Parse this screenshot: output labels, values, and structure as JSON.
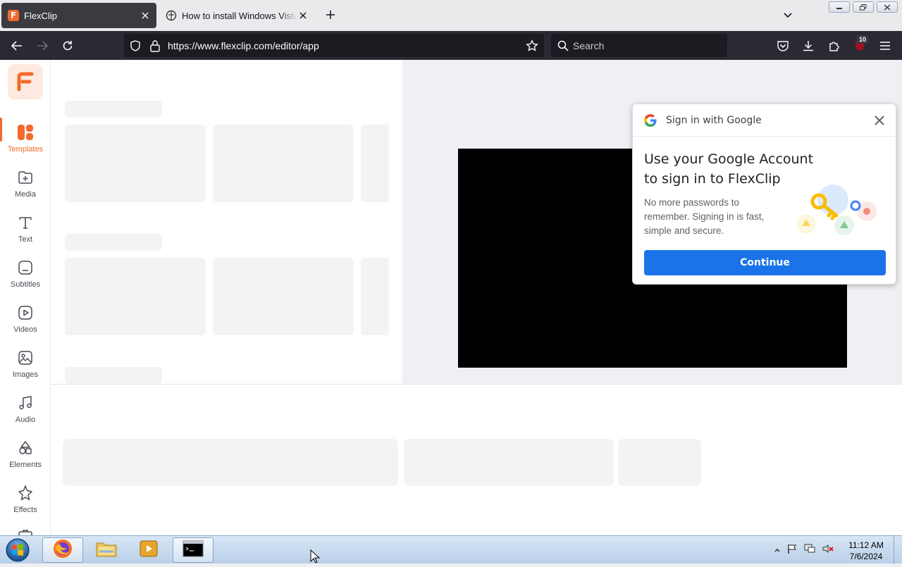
{
  "browser": {
    "tabs": [
      {
        "label": "FlexClip",
        "active": true
      },
      {
        "label": "How to install Windows Vista in",
        "active": false
      }
    ],
    "url": "https://www.flexclip.com/editor/app",
    "search_placeholder": "Search",
    "extension_badge": "10"
  },
  "app": {
    "brand_color": "#f26a2b",
    "sidebar": [
      {
        "label": "Templates",
        "icon": "templates-icon",
        "active": true
      },
      {
        "label": "Media",
        "icon": "media-icon"
      },
      {
        "label": "Text",
        "icon": "text-icon"
      },
      {
        "label": "Subtitles",
        "icon": "subtitles-icon"
      },
      {
        "label": "Videos",
        "icon": "videos-icon"
      },
      {
        "label": "Images",
        "icon": "images-icon"
      },
      {
        "label": "Audio",
        "icon": "audio-icon"
      },
      {
        "label": "Elements",
        "icon": "elements-icon"
      },
      {
        "label": "Effects",
        "icon": "effects-icon"
      }
    ]
  },
  "google_popup": {
    "header": "Sign in with Google",
    "title": "Use your Google Account to sign in to FlexClip",
    "description": "No more passwords to remember. Signing in is fast, simple and secure.",
    "button": "Continue",
    "button_color": "#1a73e8"
  },
  "taskbar": {
    "time": "11:12 AM",
    "date": "7/6/2024"
  }
}
